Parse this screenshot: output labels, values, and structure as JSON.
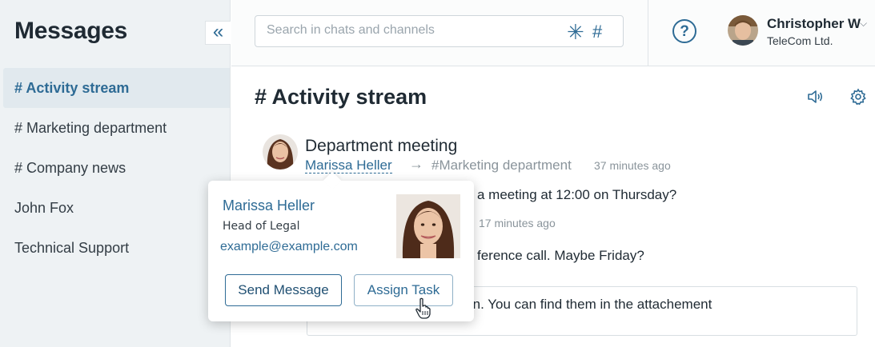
{
  "sidebar": {
    "title": "Messages",
    "collapse_glyph": "«",
    "items": [
      {
        "label": "# Activity stream",
        "active": true
      },
      {
        "label": "# Marketing department",
        "active": false
      },
      {
        "label": "# Company news",
        "active": false
      },
      {
        "label": "John Fox",
        "active": false
      },
      {
        "label": "Technical Support",
        "active": false
      }
    ]
  },
  "topbar": {
    "search_placeholder": "Search in chats and channels",
    "search_asterisk": "✳",
    "search_hash": "#",
    "help_glyph": "?",
    "user": {
      "name": "Christopher W",
      "company": "TeleCom Ltd.",
      "chevron": "⌵"
    }
  },
  "channel": {
    "title": "# Activity stream",
    "icons": [
      "speaker-icon",
      "gear-icon"
    ]
  },
  "post": {
    "title": "Department meeting",
    "author": "Marissa Heller",
    "arrow": "→",
    "channel": "#Marketing department",
    "time": "37 minutes ago"
  },
  "messages": [
    {
      "text": "a meeting at 12:00 on Thursday?"
    },
    {
      "time": "17 minutes ago"
    },
    {
      "text": "ference call. Maybe Friday?"
    }
  ],
  "reply": {
    "text": "on how to improve the plan. You can find them in the attachement"
  },
  "popup": {
    "name": "Marissa Heller",
    "role": "Head of Legal",
    "email": "example@example.com",
    "send_label": "Send Message",
    "assign_label": "Assign Task"
  },
  "colors": {
    "accent": "#2e6b95",
    "sidebar_bg": "#eef2f4",
    "muted_text": "#8a949b"
  }
}
